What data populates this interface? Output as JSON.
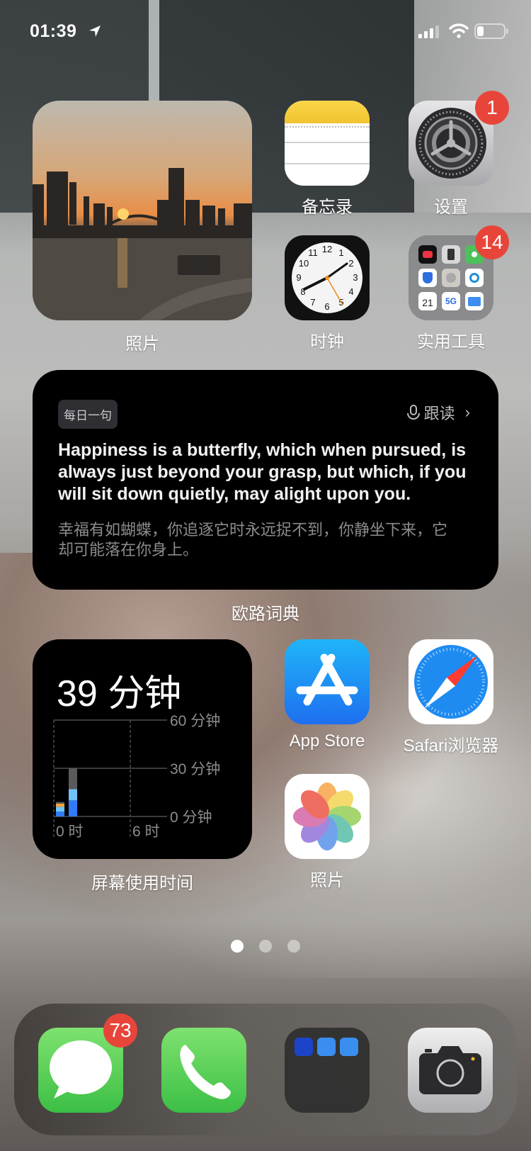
{
  "status_bar": {
    "time": "01:39",
    "location_icon": "location-arrow-icon",
    "signal_icon": "cellular-signal-icon",
    "wifi_icon": "wifi-icon",
    "battery_icon": "battery-low-icon",
    "battery_level_fraction": 0.2
  },
  "widgets": {
    "photos": {
      "label": "照片"
    },
    "quote": {
      "tag": "每日一句",
      "follow_label": "跟读",
      "english": "Happiness is a butterfly, which when pursued, is always just beyond your grasp, but which, if you will sit down quietly, may alight upon you.",
      "chinese": "幸福有如蝴蝶，你追逐它时永远捉不到，你静坐下来，它却可能落在你身上。",
      "label": "欧路词典"
    },
    "screen_time": {
      "total": "39 分钟",
      "label": "屏幕使用时间",
      "chart_data": {
        "type": "bar",
        "stacked": true,
        "y_ticks": [
          "60 分钟",
          "30 分钟",
          "0 分钟"
        ],
        "x_ticks": [
          "0 时",
          "6 时"
        ],
        "ylim": [
          0,
          60
        ],
        "bars": [
          {
            "hour": 0,
            "segments": [
              {
                "category": "blue",
                "value": 3
              },
              {
                "category": "lightblue",
                "value": 3
              },
              {
                "category": "orange",
                "value": 2
              },
              {
                "category": "gray",
                "value": 1
              }
            ]
          },
          {
            "hour": 1,
            "segments": [
              {
                "category": "blue",
                "value": 10
              },
              {
                "category": "lightblue",
                "value": 7
              },
              {
                "category": "gray",
                "value": 13
              }
            ]
          }
        ],
        "colors": {
          "blue": "#2f7cf6",
          "lightblue": "#6fc3f7",
          "orange": "#f2a33a",
          "gray": "#5a5a5a"
        }
      }
    }
  },
  "apps": [
    {
      "id": "notes",
      "label": "备忘录"
    },
    {
      "id": "settings",
      "label": "设置",
      "badge": "1"
    },
    {
      "id": "clock",
      "label": "时钟"
    },
    {
      "id": "utilities",
      "label": "实用工具",
      "badge": "14"
    },
    {
      "id": "app-store",
      "label": "App Store"
    },
    {
      "id": "safari",
      "label": "Safari浏览器"
    },
    {
      "id": "photos",
      "label": "照片"
    }
  ],
  "page_indicator": {
    "pages": 3,
    "current": 1
  },
  "dock": [
    {
      "id": "messages",
      "badge": "73"
    },
    {
      "id": "phone"
    },
    {
      "id": "dictionary-folder"
    },
    {
      "id": "camera"
    }
  ]
}
